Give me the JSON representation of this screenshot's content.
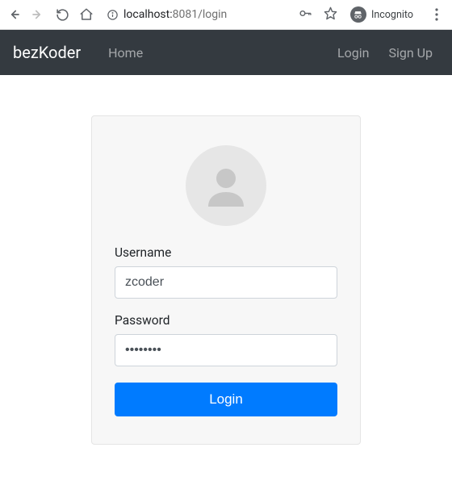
{
  "browser": {
    "url_host": "localhost:",
    "url_port_path": "8081/login",
    "incognito_label": "Incognito"
  },
  "navbar": {
    "brand": "bezKoder",
    "links": {
      "home": "Home",
      "login": "Login",
      "signup": "Sign Up"
    }
  },
  "form": {
    "username_label": "Username",
    "username_value": "zcoder",
    "password_label": "Password",
    "password_value": "••••••••",
    "submit_label": "Login"
  }
}
